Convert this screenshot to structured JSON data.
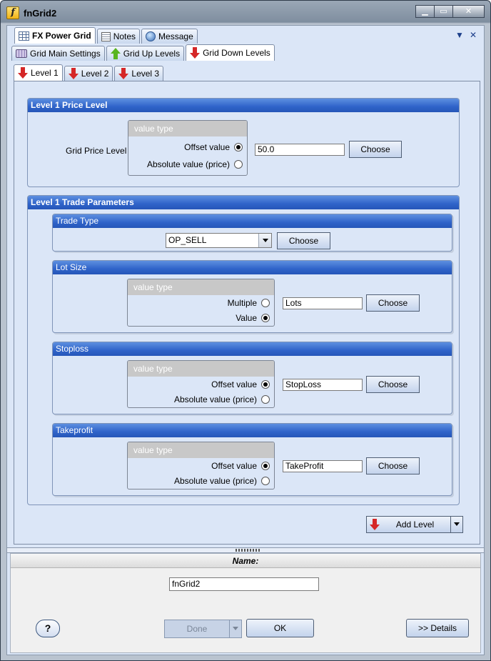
{
  "window": {
    "title": "fnGrid2"
  },
  "top_tabs": [
    {
      "label": "FX Power Grid",
      "icon": "grid-icon"
    },
    {
      "label": "Notes",
      "icon": "notes-icon"
    },
    {
      "label": "Message",
      "icon": "message-icon"
    }
  ],
  "sub_tabs": [
    {
      "label": "Grid Main Settings",
      "icon": "keyboard-icon"
    },
    {
      "label": "Grid Up Levels",
      "icon": "arrow-up-icon"
    },
    {
      "label": "Grid Down Levels",
      "icon": "arrow-down-icon"
    }
  ],
  "level_tabs": [
    {
      "label": "Level 1"
    },
    {
      "label": "Level 2"
    },
    {
      "label": "Level 3"
    }
  ],
  "price_level": {
    "title": "Level 1 Price Level",
    "label": "Grid Price Level",
    "value_type_title": "value type",
    "option_offset": "Offset value",
    "option_absolute": "Absolute value (price)",
    "value": "50.0",
    "choose": "Choose"
  },
  "trade_params": {
    "title": "Level 1 Trade Parameters",
    "trade_type": {
      "title": "Trade Type",
      "value": "OP_SELL",
      "choose": "Choose"
    },
    "lot_size": {
      "title": "Lot Size",
      "value_type_title": "value type",
      "option_a": "Multiple",
      "option_b": "Value",
      "value": "Lots",
      "choose": "Choose"
    },
    "stoploss": {
      "title": "Stoploss",
      "value_type_title": "value type",
      "option_a": "Offset value",
      "option_b": "Absolute value (price)",
      "value": "StopLoss",
      "choose": "Choose"
    },
    "takeprofit": {
      "title": "Takeprofit",
      "value_type_title": "value type",
      "option_a": "Offset value",
      "option_b": "Absolute value (price)",
      "value": "TakeProfit",
      "choose": "Choose"
    }
  },
  "add_level": "Add Level",
  "name_section": {
    "label": "Name:",
    "value": "fnGrid2"
  },
  "footer": {
    "help": "?",
    "done": "Done",
    "ok": "OK",
    "details": ">> Details"
  }
}
